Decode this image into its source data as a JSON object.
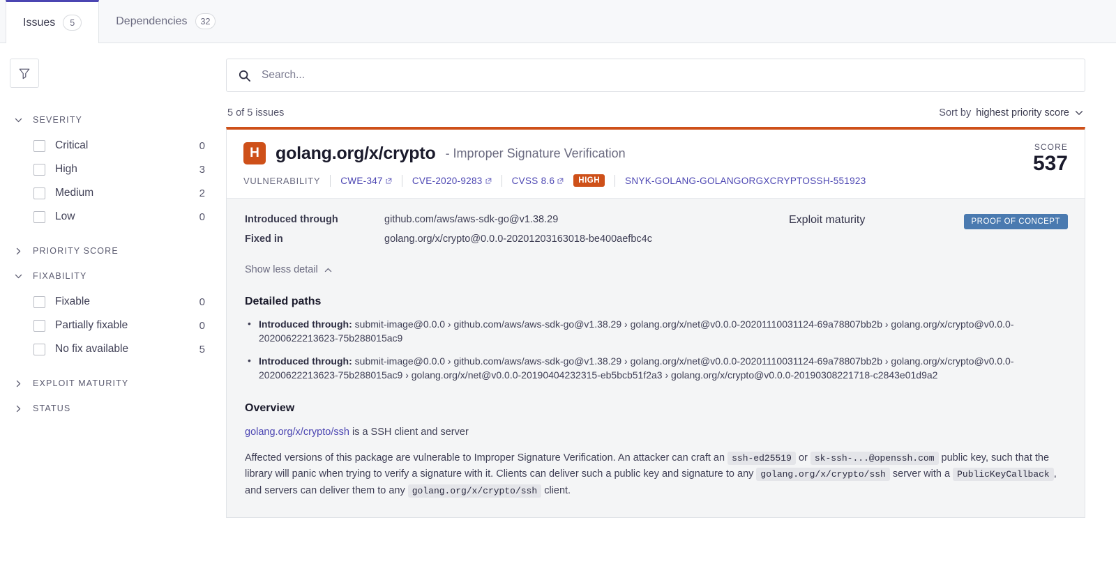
{
  "tabs": [
    {
      "label": "Issues",
      "count": "5",
      "active": true
    },
    {
      "label": "Dependencies",
      "count": "32",
      "active": false
    }
  ],
  "sidebar": {
    "filter_icon": "funnel-icon",
    "facets": [
      {
        "title": "SEVERITY",
        "expanded": true,
        "items": [
          {
            "label": "Critical",
            "count": "0"
          },
          {
            "label": "High",
            "count": "3"
          },
          {
            "label": "Medium",
            "count": "2"
          },
          {
            "label": "Low",
            "count": "0"
          }
        ]
      },
      {
        "title": "PRIORITY SCORE",
        "expanded": false,
        "items": []
      },
      {
        "title": "FIXABILITY",
        "expanded": true,
        "items": [
          {
            "label": "Fixable",
            "count": "0"
          },
          {
            "label": "Partially fixable",
            "count": "0"
          },
          {
            "label": "No fix available",
            "count": "5"
          }
        ]
      },
      {
        "title": "EXPLOIT MATURITY",
        "expanded": false,
        "items": []
      },
      {
        "title": "STATUS",
        "expanded": false,
        "items": []
      }
    ]
  },
  "search": {
    "placeholder": "Search...",
    "value": "",
    "icon": "search-icon"
  },
  "results": {
    "summary": "5 of 5 issues",
    "sort_prefix": "Sort by",
    "sort_value": "highest priority score"
  },
  "issue": {
    "severity_letter": "H",
    "severity_color": "#ce5019",
    "package": "golang.org/x/crypto",
    "title_suffix": "- Improper Signature Verification",
    "meta": {
      "kind": "VULNERABILITY",
      "cwe": "CWE-347",
      "cve": "CVE-2020-9283",
      "cvss": "CVSS 8.6",
      "severity_pill": "HIGH",
      "snyk_id": "SNYK-GOLANG-GOLANGORGXCRYPTOSSH-551923"
    },
    "score_label": "SCORE",
    "score_value": "537",
    "introduced_through_label": "Introduced through",
    "introduced_through_value": "github.com/aws/aws-sdk-go@v1.38.29",
    "fixed_in_label": "Fixed in",
    "fixed_in_value": "golang.org/x/crypto@0.0.0-20201203163018-be400aefbc4c",
    "exploit_maturity_label": "Exploit maturity",
    "exploit_maturity_value": "PROOF OF CONCEPT",
    "exploit_maturity_color": "#4a7ab0",
    "show_detail_toggle": "Show less detail",
    "detailed_paths_title": "Detailed paths",
    "paths": [
      {
        "prefix": "Introduced through:",
        "chain": "submit-image@0.0.0 › github.com/aws/aws-sdk-go@v1.38.29 › golang.org/x/net@v0.0.0-20201110031124-69a78807bb2b › golang.org/x/crypto@v0.0.0-20200622213623-75b288015ac9"
      },
      {
        "prefix": "Introduced through:",
        "chain": "submit-image@0.0.0 › github.com/aws/aws-sdk-go@v1.38.29 › golang.org/x/net@v0.0.0-20201110031124-69a78807bb2b › golang.org/x/crypto@v0.0.0-20200622213623-75b288015ac9 › golang.org/x/net@v0.0.0-20190404232315-eb5bcb51f2a3 › golang.org/x/crypto@v0.0.0-20190308221718-c2843e01d9a2"
      }
    ],
    "overview_title": "Overview",
    "overview_link": "golang.org/x/crypto/ssh",
    "overview_tagline": " is a SSH client and server",
    "description": {
      "p1": "Affected versions of this package are vulnerable to Improper Signature Verification. An attacker can craft an ",
      "code1": "ssh-ed25519",
      "p2": " or ",
      "code2": "sk-ssh-...@openssh.com",
      "p3": " public key, such that the library will panic when trying to verify a signature with it. Clients can deliver such a public key and signature to any ",
      "code3": "golang.org/x/crypto/ssh",
      "p4": " server with a ",
      "code4": "PublicKeyCallback",
      "p5": ", and servers can deliver them to any ",
      "code5": "golang.org/x/crypto/ssh",
      "p6": " client."
    }
  }
}
